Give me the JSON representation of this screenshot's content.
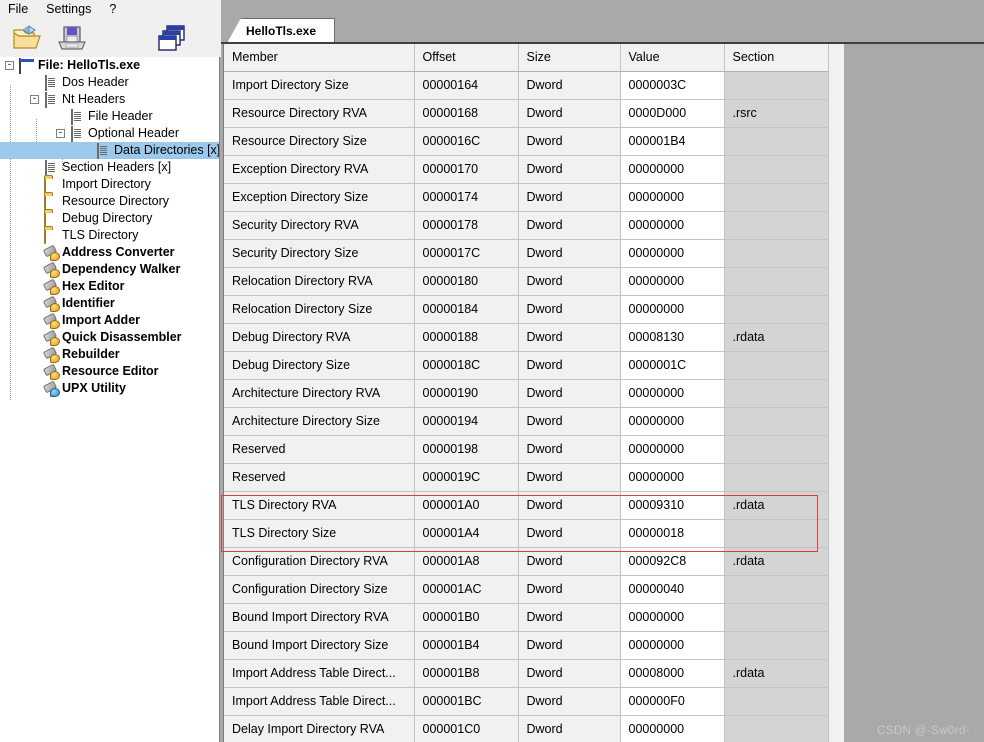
{
  "menubar": {
    "items": [
      "File",
      "Settings",
      "?"
    ]
  },
  "toolbar": {
    "buttons": [
      {
        "name": "open-file-button",
        "icon": "open-folder-icon",
        "label": "Open"
      },
      {
        "name": "save-file-button",
        "icon": "floppy-save-icon",
        "label": "Save"
      },
      {
        "name": "cascade-windows-button",
        "icon": "cascade-windows-icon",
        "label": "Windows"
      }
    ]
  },
  "tree": {
    "root": {
      "label": "File: HelloTls.exe",
      "icon": "window-icon",
      "bold": true,
      "expanded": true
    },
    "items": [
      {
        "label": "Dos Header",
        "icon": "document-icon",
        "depth": 1,
        "expander": null,
        "selected": false
      },
      {
        "label": "Nt Headers",
        "icon": "document-icon",
        "depth": 1,
        "expander": "-",
        "selected": false
      },
      {
        "label": "File Header",
        "icon": "document-icon",
        "depth": 2,
        "expander": null,
        "selected": false
      },
      {
        "label": "Optional Header",
        "icon": "document-icon",
        "depth": 2,
        "expander": "-",
        "selected": false
      },
      {
        "label": "Data Directories [x]",
        "icon": "document-icon",
        "depth": 3,
        "expander": null,
        "selected": true
      },
      {
        "label": "Section Headers [x]",
        "icon": "document-icon",
        "depth": 1,
        "expander": null,
        "selected": false
      },
      {
        "label": "Import Directory",
        "icon": "folder-icon",
        "depth": 1,
        "expander": null,
        "selected": false
      },
      {
        "label": "Resource Directory",
        "icon": "folder-icon",
        "depth": 1,
        "expander": null,
        "selected": false
      },
      {
        "label": "Debug Directory",
        "icon": "folder-icon",
        "depth": 1,
        "expander": null,
        "selected": false
      },
      {
        "label": "TLS Directory",
        "icon": "folder-icon",
        "depth": 1,
        "expander": null,
        "selected": false
      },
      {
        "label": "Address Converter",
        "icon": "tool-icon",
        "depth": 1,
        "expander": null,
        "selected": false,
        "bold": true
      },
      {
        "label": "Dependency Walker",
        "icon": "tool-icon",
        "depth": 1,
        "expander": null,
        "selected": false,
        "bold": true
      },
      {
        "label": "Hex Editor",
        "icon": "tool-icon",
        "depth": 1,
        "expander": null,
        "selected": false,
        "bold": true
      },
      {
        "label": "Identifier",
        "icon": "tool-icon",
        "depth": 1,
        "expander": null,
        "selected": false,
        "bold": true
      },
      {
        "label": "Import Adder",
        "icon": "tool-icon",
        "depth": 1,
        "expander": null,
        "selected": false,
        "bold": true
      },
      {
        "label": "Quick Disassembler",
        "icon": "tool-icon",
        "depth": 1,
        "expander": null,
        "selected": false,
        "bold": true
      },
      {
        "label": "Rebuilder",
        "icon": "tool-icon",
        "depth": 1,
        "expander": null,
        "selected": false,
        "bold": true
      },
      {
        "label": "Resource Editor",
        "icon": "tool-icon",
        "depth": 1,
        "expander": null,
        "selected": false,
        "bold": true
      },
      {
        "label": "UPX Utility",
        "icon": "tool-icon-blue",
        "depth": 1,
        "expander": null,
        "selected": false,
        "bold": true
      }
    ]
  },
  "tabs": [
    {
      "label": "HelloTls.exe",
      "active": true
    }
  ],
  "table": {
    "columns": [
      "Member",
      "Offset",
      "Size",
      "Value",
      "Section"
    ],
    "rows": [
      {
        "member": "Import Directory Size",
        "offset": "00000164",
        "size": "Dword",
        "value": "0000003C",
        "section": ""
      },
      {
        "member": "Resource Directory RVA",
        "offset": "00000168",
        "size": "Dword",
        "value": "0000D000",
        "section": ".rsrc"
      },
      {
        "member": "Resource Directory Size",
        "offset": "0000016C",
        "size": "Dword",
        "value": "000001B4",
        "section": ""
      },
      {
        "member": "Exception Directory RVA",
        "offset": "00000170",
        "size": "Dword",
        "value": "00000000",
        "section": ""
      },
      {
        "member": "Exception Directory Size",
        "offset": "00000174",
        "size": "Dword",
        "value": "00000000",
        "section": ""
      },
      {
        "member": "Security Directory RVA",
        "offset": "00000178",
        "size": "Dword",
        "value": "00000000",
        "section": ""
      },
      {
        "member": "Security Directory Size",
        "offset": "0000017C",
        "size": "Dword",
        "value": "00000000",
        "section": ""
      },
      {
        "member": "Relocation Directory RVA",
        "offset": "00000180",
        "size": "Dword",
        "value": "00000000",
        "section": ""
      },
      {
        "member": "Relocation Directory Size",
        "offset": "00000184",
        "size": "Dword",
        "value": "00000000",
        "section": ""
      },
      {
        "member": "Debug Directory RVA",
        "offset": "00000188",
        "size": "Dword",
        "value": "00008130",
        "section": ".rdata"
      },
      {
        "member": "Debug Directory Size",
        "offset": "0000018C",
        "size": "Dword",
        "value": "0000001C",
        "section": ""
      },
      {
        "member": "Architecture Directory RVA",
        "offset": "00000190",
        "size": "Dword",
        "value": "00000000",
        "section": ""
      },
      {
        "member": "Architecture Directory Size",
        "offset": "00000194",
        "size": "Dword",
        "value": "00000000",
        "section": ""
      },
      {
        "member": "Reserved",
        "offset": "00000198",
        "size": "Dword",
        "value": "00000000",
        "section": ""
      },
      {
        "member": "Reserved",
        "offset": "0000019C",
        "size": "Dword",
        "value": "00000000",
        "section": ""
      },
      {
        "member": "TLS Directory RVA",
        "offset": "000001A0",
        "size": "Dword",
        "value": "00009310",
        "section": ".rdata"
      },
      {
        "member": "TLS Directory Size",
        "offset": "000001A4",
        "size": "Dword",
        "value": "00000018",
        "section": ""
      },
      {
        "member": "Configuration Directory RVA",
        "offset": "000001A8",
        "size": "Dword",
        "value": "000092C8",
        "section": ".rdata"
      },
      {
        "member": "Configuration Directory Size",
        "offset": "000001AC",
        "size": "Dword",
        "value": "00000040",
        "section": ""
      },
      {
        "member": "Bound Import Directory RVA",
        "offset": "000001B0",
        "size": "Dword",
        "value": "00000000",
        "section": ""
      },
      {
        "member": "Bound Import Directory Size",
        "offset": "000001B4",
        "size": "Dword",
        "value": "00000000",
        "section": ""
      },
      {
        "member": "Import Address Table Direct...",
        "offset": "000001B8",
        "size": "Dword",
        "value": "00008000",
        "section": ".rdata"
      },
      {
        "member": "Import Address Table Direct...",
        "offset": "000001BC",
        "size": "Dword",
        "value": "000000F0",
        "section": ""
      },
      {
        "member": "Delay Import Directory RVA",
        "offset": "000001C0",
        "size": "Dword",
        "value": "00000000",
        "section": ""
      }
    ]
  },
  "annotation": {
    "highlight_color": "#e23b3b",
    "highlight_rows": [
      "TLS Directory RVA",
      "TLS Directory Size"
    ]
  },
  "watermark": {
    "text": "CSDN @-Sw0rd-"
  },
  "colors": {
    "selection": "#9cc8ec",
    "window_bg": "#a9a9a9",
    "grid_bg": "#f1f1f1",
    "value_cell_bg": "#ffffff",
    "section_cell_bg": "#d4d4d4"
  }
}
